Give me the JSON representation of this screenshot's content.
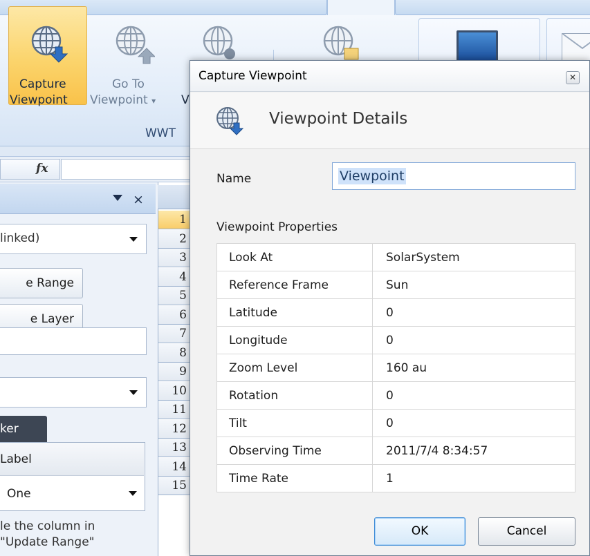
{
  "ribbon": {
    "capture_line1": "Capture",
    "capture_line2": "Viewpoint",
    "goto_line1": "Go To",
    "goto_line2": "Viewpoint",
    "goto_caret": "▾",
    "partial_v": "V",
    "group_label": "WWT"
  },
  "formula_bar": {
    "fx": "fx"
  },
  "task_pane": {
    "combo_text": "linked)",
    "update_range_btn": "e Range",
    "update_layer_btn": "e Layer",
    "tab_label": "ker",
    "grid_header": "Label",
    "grid_value": "One",
    "hint_line1": "le the column in",
    "hint_line2": "\"Update Range\""
  },
  "sheet": {
    "rows": [
      "1",
      "2",
      "3",
      "4",
      "5",
      "6",
      "7",
      "8",
      "9",
      "10",
      "11",
      "12",
      "13",
      "14",
      "15"
    ],
    "active_row": "1"
  },
  "dialog": {
    "title": "Capture Viewpoint",
    "close_glyph": "✕",
    "heading": "Viewpoint Details",
    "name_label": "Name",
    "name_value": "Viewpoint",
    "properties_label": "Viewpoint Properties",
    "properties": [
      {
        "key": "Look At",
        "value": "SolarSystem"
      },
      {
        "key": "Reference Frame",
        "value": "Sun"
      },
      {
        "key": "Latitude",
        "value": "0"
      },
      {
        "key": "Longitude",
        "value": "0"
      },
      {
        "key": "Zoom Level",
        "value": "160 au"
      },
      {
        "key": "Rotation",
        "value": "0"
      },
      {
        "key": "Tilt",
        "value": "0"
      },
      {
        "key": "Observing Time",
        "value": "2011/7/4 8:34:57"
      },
      {
        "key": "Time Rate",
        "value": "1"
      }
    ],
    "ok_label": "OK",
    "cancel_label": "Cancel"
  },
  "icons": [
    "globe-capture-icon",
    "globe-goto-icon",
    "globe-settings-icon",
    "globe-layer-icon",
    "monitor-icon",
    "envelope-icon",
    "dropdown-arrow-icon",
    "close-icon"
  ]
}
